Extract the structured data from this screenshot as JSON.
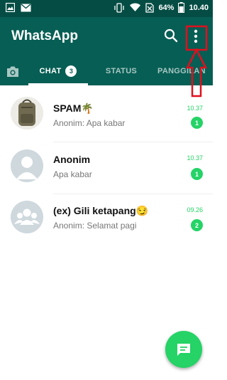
{
  "status_bar": {
    "battery_percent": "64%",
    "time": "10.40",
    "icons": [
      "gallery-icon",
      "email-icon",
      "vibrate-icon",
      "wifi-icon",
      "no-sim-icon",
      "battery-icon"
    ]
  },
  "app_bar": {
    "title": "WhatsApp",
    "icons": [
      "search-icon",
      "more-vert-icon"
    ]
  },
  "tabs": [
    {
      "label": "",
      "icon": "camera-icon"
    },
    {
      "label": "CHAT",
      "badge": "3",
      "active": true
    },
    {
      "label": "STATUS"
    },
    {
      "label": "PANGGILAN"
    }
  ],
  "chats": [
    {
      "name": "SPAM🌴",
      "sender": "Anonim:",
      "message": "Apa kabar",
      "time": "10.37",
      "unread": "1",
      "avatar": "backpack-photo"
    },
    {
      "name": "Anonim",
      "sender": "",
      "message": "Apa kabar",
      "time": "10.37",
      "unread": "1",
      "avatar": "default-person-avatar"
    },
    {
      "name": "(ex) Gili ketapang😏",
      "sender": "Anonim:",
      "message": "Selamat pagi",
      "time": "09.26",
      "unread": "2",
      "avatar": "default-group-avatar"
    }
  ],
  "fab": {
    "icon": "new-chat-icon"
  },
  "colors": {
    "status_bar": "#054d44",
    "header": "#075e54",
    "accent": "#25d366",
    "annotation": "#e0101e"
  }
}
